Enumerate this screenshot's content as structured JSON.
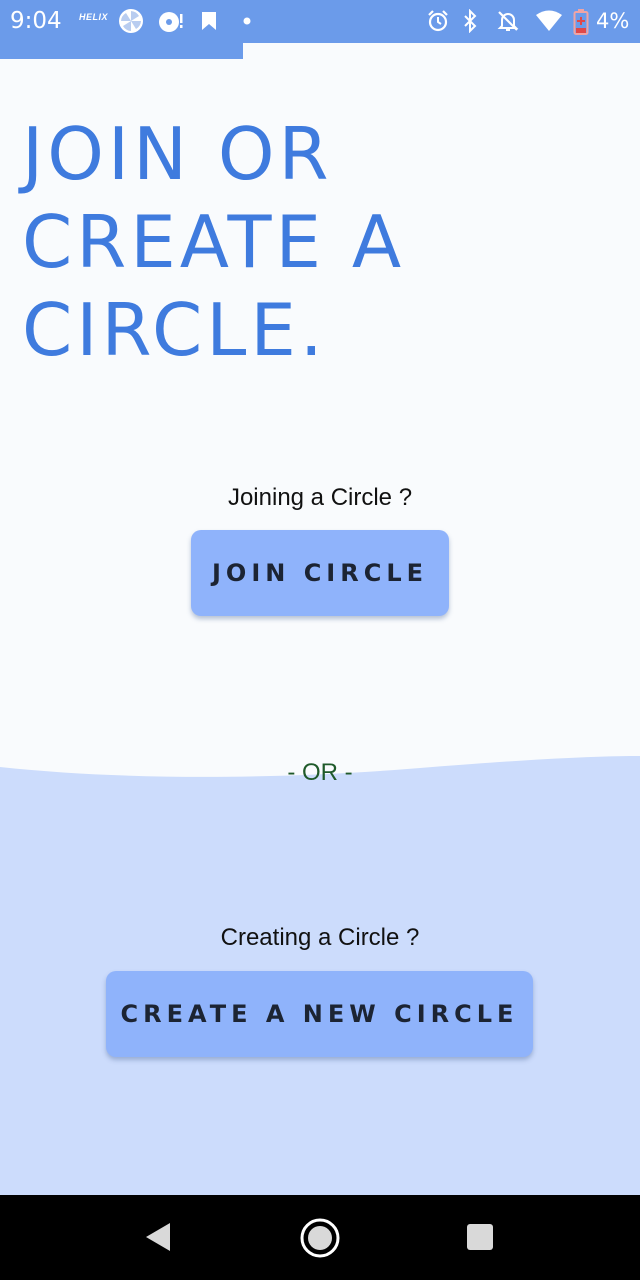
{
  "status_bar": {
    "time": "9:04",
    "helix_label": "HELIX",
    "battery_percent": "4%",
    "icons": [
      "helix-icon",
      "pinwheel-icon",
      "disc-icon",
      "bookmark-icon",
      "dot-icon",
      "alarm-icon",
      "bluetooth-icon",
      "bell-off-icon",
      "wifi-icon",
      "battery-low-icon"
    ]
  },
  "headline": {
    "line1": "JOIN OR",
    "line2": "CREATE A",
    "line3": "CIRCLE."
  },
  "join_section": {
    "prompt": "Joining a Circle ?",
    "button_label": "JOIN CIRCLE"
  },
  "divider_label": "- OR -",
  "create_section": {
    "prompt": "Creating a Circle ?",
    "button_label": "CREATE A NEW CIRCLE"
  },
  "navigation": {
    "icons": [
      "back-icon",
      "home-icon",
      "recents-icon"
    ]
  },
  "colors": {
    "accent": "#6b9bea",
    "headline": "#3f7bde",
    "button": "#8fb3fb",
    "lower_background": "#ccdcfc",
    "or_text": "#1f5a2a"
  }
}
